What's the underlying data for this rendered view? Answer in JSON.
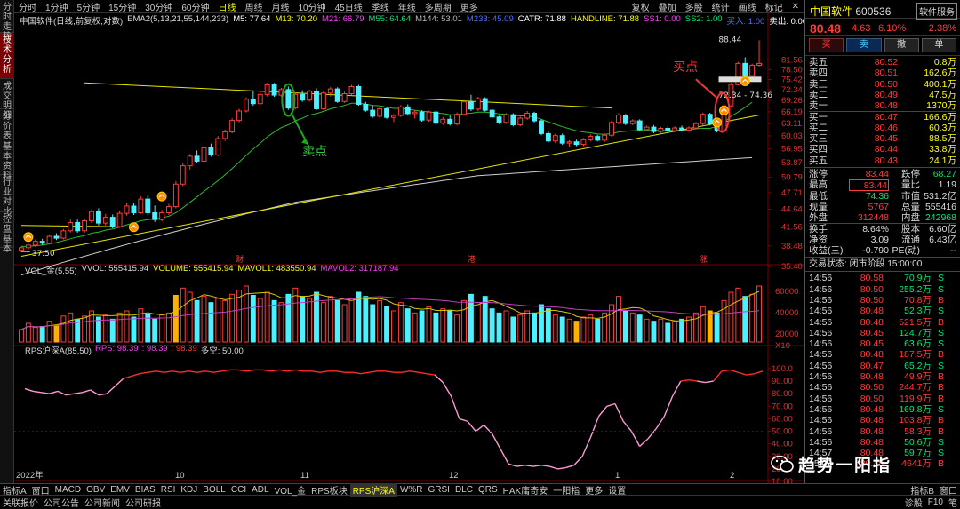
{
  "left_tabs": [
    "分时走势",
    "技术分析",
    "成交明细",
    "分价表",
    "基本资料",
    "行业对比",
    "控盘基本"
  ],
  "periods": [
    "分时",
    "1分钟",
    "5分钟",
    "15分钟",
    "30分钟",
    "60分钟",
    "日线",
    "周线",
    "月线",
    "10分钟",
    "45日线",
    "季线",
    "年线",
    "多周期",
    "更多"
  ],
  "active_period": "日线",
  "tools": [
    "复权",
    "叠加",
    "多股",
    "统计",
    "画线",
    "标记"
  ],
  "main_header": {
    "title": "中国软件(日线,前复权,对数)",
    "ema": "EMA2(5,13,21,55,144,233)",
    "m5": "M5: 77.64",
    "m13": "M13: 70.20",
    "m21": "M21: 66.79",
    "m55": "M55: 64.64",
    "m144": "M144: 53.01",
    "m233": "M233: 45.09",
    "catr": "CATR: 71.88",
    "handline": "HANDLINE: 71.88",
    "ss1": "SS1: 0.00",
    "ss2": "SS2: 1.00",
    "buy": "买入: 1.00",
    "sell": "卖出: 0.00"
  },
  "price_axis": [
    "81.56",
    "78.50",
    "75.42",
    "72.34",
    "69.26",
    "66.19",
    "63.11",
    "60.03",
    "56.95",
    "53.87",
    "50.79",
    "47.71",
    "44.64",
    "41.56",
    "38.48",
    "35.40"
  ],
  "annotations": {
    "high": "88.44",
    "range": "72.34 - 74.36",
    "low": "37.50",
    "sell_label": "卖点",
    "buy_label": "买点",
    "events": [
      "财",
      "港",
      "涨"
    ]
  },
  "vol_header": {
    "title": "VOL_金(5,55)",
    "vvol": "VVOL: 555415.94",
    "volume": "VOLUME: 555415.94",
    "mavol1": "MAVOL1: 483550.94",
    "mavol2": "MAVOL2: 317187.94"
  },
  "vol_axis": [
    "60000",
    "40000",
    "20000",
    "X10"
  ],
  "rps_header": {
    "title": "RPS沪深A(85,50)",
    "rps": "RPS: 98.39",
    "v2": ": 98.39",
    "v3": ": 98.39",
    "ds": "多空: 50.00"
  },
  "rps_axis": [
    "100.0",
    "90.00",
    "80.00",
    "70.00",
    "60.00",
    "50.00",
    "40.00",
    "30.00",
    "20.00",
    "10.00"
  ],
  "date_labels": [
    "2022年",
    "10",
    "11",
    "12",
    "1",
    "2"
  ],
  "chart_data": {
    "type": "candlestick",
    "title": "中国软件(日线,前复权,对数)",
    "ylim": [
      35.4,
      88.5
    ],
    "log_scale": true,
    "candles": [
      [
        37.8,
        38.4,
        37.5,
        38.2
      ],
      [
        38.2,
        38.8,
        37.9,
        38.6
      ],
      [
        38.6,
        39.5,
        38.3,
        39.2
      ],
      [
        39.2,
        39.6,
        38.6,
        38.9
      ],
      [
        38.9,
        40.3,
        38.7,
        40.0
      ],
      [
        40.0,
        40.5,
        39.4,
        39.7
      ],
      [
        39.7,
        41.2,
        39.5,
        40.9
      ],
      [
        40.9,
        42.8,
        40.6,
        42.3
      ],
      [
        42.3,
        42.8,
        40.6,
        40.9
      ],
      [
        40.9,
        43.0,
        40.6,
        42.6
      ],
      [
        42.6,
        44.6,
        42.2,
        44.2
      ],
      [
        44.2,
        44.8,
        41.8,
        42.2
      ],
      [
        42.2,
        43.8,
        41.8,
        43.2
      ],
      [
        43.2,
        43.7,
        41.3,
        41.6
      ],
      [
        41.6,
        44.4,
        41.4,
        43.9
      ],
      [
        43.9,
        45.7,
        43.5,
        45.2
      ],
      [
        45.2,
        45.7,
        43.6,
        44.0
      ],
      [
        44.0,
        47.0,
        43.8,
        46.5
      ],
      [
        46.5,
        47.2,
        43.6,
        44.0
      ],
      [
        44.0,
        45.3,
        42.4,
        42.8
      ],
      [
        42.8,
        44.5,
        42.5,
        44.0
      ],
      [
        44.0,
        45.6,
        43.6,
        45.1
      ],
      [
        45.1,
        50.0,
        44.8,
        49.4
      ],
      [
        49.4,
        53.8,
        49.0,
        53.2
      ],
      [
        53.2,
        55.8,
        52.4,
        55.3
      ],
      [
        55.3,
        56.6,
        53.8,
        54.2
      ],
      [
        54.2,
        57.8,
        53.8,
        57.2
      ],
      [
        57.2,
        58.2,
        55.2,
        55.6
      ],
      [
        55.6,
        60.0,
        55.3,
        59.4
      ],
      [
        59.4,
        61.6,
        58.8,
        61.0
      ],
      [
        61.0,
        64.5,
        60.7,
        63.9
      ],
      [
        63.9,
        67.0,
        63.4,
        66.4
      ],
      [
        66.4,
        70.2,
        66.0,
        69.6
      ],
      [
        69.6,
        72.0,
        67.8,
        68.4
      ],
      [
        68.4,
        71.5,
        68.0,
        71.0
      ],
      [
        71.0,
        74.4,
        70.4,
        73.8
      ],
      [
        73.8,
        74.4,
        70.3,
        70.8
      ],
      [
        70.8,
        72.9,
        70.3,
        72.4
      ],
      [
        72.4,
        73.3,
        66.7,
        67.2
      ],
      [
        67.2,
        71.5,
        66.8,
        71.0
      ],
      [
        71.0,
        72.2,
        68.9,
        69.4
      ],
      [
        69.4,
        72.4,
        69.0,
        71.9
      ],
      [
        71.9,
        72.8,
        66.6,
        67.0
      ],
      [
        67.0,
        72.0,
        66.6,
        71.4
      ],
      [
        71.4,
        73.2,
        70.4,
        72.6
      ],
      [
        72.6,
        73.1,
        68.6,
        69.0
      ],
      [
        69.0,
        71.8,
        68.6,
        71.2
      ],
      [
        71.2,
        73.8,
        70.8,
        73.3
      ],
      [
        73.3,
        73.8,
        67.8,
        68.2
      ],
      [
        68.2,
        68.9,
        66.2,
        66.6
      ],
      [
        66.6,
        68.0,
        64.6,
        65.0
      ],
      [
        65.0,
        67.5,
        64.6,
        67.0
      ],
      [
        67.0,
        67.6,
        64.3,
        64.7
      ],
      [
        64.7,
        65.6,
        63.5,
        65.2
      ],
      [
        65.2,
        68.0,
        64.8,
        67.5
      ],
      [
        67.5,
        68.2,
        65.3,
        65.7
      ],
      [
        65.7,
        66.6,
        64.4,
        66.1
      ],
      [
        66.1,
        66.6,
        63.6,
        64.0
      ],
      [
        64.0,
        66.5,
        63.6,
        66.1
      ],
      [
        66.1,
        66.6,
        62.8,
        63.2
      ],
      [
        63.2,
        64.8,
        62.8,
        64.2
      ],
      [
        64.2,
        65.4,
        62.6,
        63.0
      ],
      [
        63.0,
        66.0,
        62.6,
        65.5
      ],
      [
        65.5,
        69.4,
        65.2,
        68.9
      ],
      [
        68.9,
        70.9,
        66.4,
        66.9
      ],
      [
        66.9,
        70.3,
        66.4,
        69.8
      ],
      [
        69.8,
        70.2,
        66.2,
        66.6
      ],
      [
        66.6,
        67.0,
        64.4,
        64.8
      ],
      [
        64.8,
        65.1,
        63.0,
        63.4
      ],
      [
        63.4,
        65.8,
        63.0,
        65.4
      ],
      [
        65.4,
        65.8,
        62.4,
        62.8
      ],
      [
        62.8,
        64.9,
        62.4,
        64.5
      ],
      [
        64.5,
        66.4,
        64.1,
        65.8
      ],
      [
        65.8,
        66.2,
        63.4,
        63.8
      ],
      [
        63.8,
        64.2,
        60.2,
        60.6
      ],
      [
        60.6,
        61.1,
        58.4,
        58.8
      ],
      [
        58.8,
        60.6,
        58.3,
        60.1
      ],
      [
        60.1,
        60.6,
        57.9,
        58.3
      ],
      [
        58.3,
        59.0,
        57.5,
        58.6
      ],
      [
        58.6,
        59.1,
        57.6,
        58.0
      ],
      [
        58.0,
        59.5,
        57.6,
        59.1
      ],
      [
        59.1,
        60.4,
        58.7,
        59.9
      ],
      [
        59.9,
        60.3,
        58.7,
        59.0
      ],
      [
        59.0,
        60.6,
        58.6,
        60.2
      ],
      [
        60.2,
        63.9,
        59.8,
        63.4
      ],
      [
        63.4,
        65.8,
        62.9,
        65.3
      ],
      [
        65.3,
        65.6,
        62.7,
        63.1
      ],
      [
        63.1,
        64.2,
        62.7,
        63.8
      ],
      [
        63.8,
        64.2,
        61.2,
        61.6
      ],
      [
        61.6,
        62.6,
        61.2,
        62.2
      ],
      [
        62.2,
        62.7,
        60.7,
        61.1
      ],
      [
        61.1,
        62.3,
        60.7,
        61.9
      ],
      [
        61.9,
        62.4,
        60.9,
        61.3
      ],
      [
        61.3,
        62.4,
        60.9,
        62.0
      ],
      [
        62.0,
        62.6,
        61.1,
        61.5
      ],
      [
        61.5,
        62.4,
        61.1,
        62.0
      ],
      [
        62.0,
        63.5,
        61.6,
        63.1
      ],
      [
        63.1,
        66.0,
        62.6,
        65.5
      ],
      [
        65.5,
        65.9,
        62.6,
        63.0
      ],
      [
        63.0,
        63.4,
        60.9,
        61.3
      ],
      [
        61.3,
        68.3,
        61.1,
        67.8
      ],
      [
        67.8,
        74.4,
        67.4,
        73.9
      ],
      [
        73.9,
        81.0,
        73.6,
        80.5
      ],
      [
        80.5,
        82.5,
        76.2,
        76.6
      ],
      [
        76.6,
        80.4,
        76.2,
        79.9
      ],
      [
        79.9,
        88.4,
        79.5,
        80.5
      ]
    ],
    "ma_green": [
      38.4,
      38.4,
      38.5,
      38.6,
      38.8,
      39.0,
      39.3,
      39.6,
      39.9,
      40.1,
      40.5,
      40.7,
      41.0,
      41.2,
      41.5,
      41.9,
      42.2,
      42.6,
      42.8,
      42.9,
      43.1,
      43.4,
      44.0,
      44.9,
      45.9,
      46.9,
      48.0,
      49.0,
      50.1,
      51.3,
      52.6,
      54.0,
      55.5,
      56.9,
      58.3,
      59.8,
      61.0,
      62.1,
      62.8,
      63.8,
      64.5,
      65.3,
      65.7,
      66.3,
      67.0,
      67.4,
      67.9,
      68.5,
      68.5,
      68.3,
      67.9,
      67.8,
      67.4,
      67.1,
      67.1,
      66.9,
      66.6,
      66.3,
      66.2,
      65.9,
      65.7,
      65.4,
      65.4,
      65.7,
      65.8,
      66.1,
      66.1,
      65.9,
      65.6,
      65.5,
      65.2,
      65.1,
      65.1,
      64.8,
      64.2,
      63.5,
      62.9,
      62.3,
      61.8,
      61.3,
      61.0,
      60.8,
      60.5,
      60.4,
      60.6,
      61.0,
      61.2,
      61.3,
      61.4,
      61.4,
      61.4,
      61.4,
      61.4,
      61.4,
      61.4,
      61.5,
      61.8,
      61.9,
      61.9,
      62.4,
      63.4,
      65.0,
      66.1,
      67.4,
      68.8
    ],
    "ma_white": [
      34.2,
      34.5,
      34.8,
      35.1,
      35.4,
      35.7,
      36.0,
      36.3,
      36.6,
      36.9,
      37.2,
      37.5,
      37.8,
      38.1,
      38.4,
      38.7,
      39.0,
      39.3,
      39.6,
      39.9,
      40.2,
      40.5,
      40.8,
      41.1,
      41.4,
      41.7,
      42.0,
      42.3,
      42.6,
      42.9,
      43.2,
      43.5,
      43.8,
      44.1,
      44.4,
      44.7,
      45.0,
      45.3,
      45.6,
      45.9,
      46.1,
      46.3,
      46.5,
      46.7,
      46.9,
      47.1,
      47.3,
      47.5,
      47.7,
      47.9,
      48.1,
      48.3,
      48.5,
      48.7,
      48.9,
      49.1,
      49.3,
      49.5,
      49.7,
      49.9,
      50.1,
      50.3,
      50.5,
      50.7,
      50.9,
      51.1,
      51.2,
      51.3,
      51.4,
      51.5,
      51.6,
      51.7,
      51.8,
      51.9,
      52.0,
      52.1,
      52.2,
      52.3,
      52.4,
      52.5,
      52.6,
      52.7,
      52.8,
      52.9,
      53.0,
      53.1,
      53.2,
      53.3,
      53.4,
      53.5,
      53.6,
      53.7,
      53.8,
      53.9,
      54.0,
      54.1,
      54.2,
      54.3,
      54.4,
      54.5,
      54.6,
      54.7,
      54.8,
      54.9,
      55.0
    ],
    "trend_lines": [
      {
        "color": "#e6e600",
        "points": [
          [
            9,
            74.4
          ],
          [
            84,
            67.2
          ]
        ]
      },
      {
        "color": "#e6e600",
        "points": [
          [
            0,
            36.9
          ],
          [
            105,
            65.3
          ]
        ]
      },
      {
        "color": "#e6e600",
        "points": [
          [
            0,
            41.8
          ],
          [
            13,
            41.6
          ]
        ]
      }
    ],
    "volume": [
      12,
      18,
      14,
      15,
      20,
      16,
      25,
      28,
      22,
      25,
      30,
      24,
      26,
      22,
      28,
      30,
      24,
      32,
      27,
      22,
      26,
      28,
      45,
      52,
      48,
      40,
      44,
      38,
      42,
      40,
      46,
      50,
      54,
      45,
      42,
      48,
      40,
      38,
      46,
      52,
      44,
      42,
      48,
      38,
      44,
      40,
      36,
      42,
      48,
      44,
      36,
      40,
      34,
      30,
      38,
      32,
      28,
      30,
      34,
      28,
      32,
      30,
      26,
      40,
      46,
      38,
      44,
      32,
      28,
      30,
      24,
      26,
      30,
      28,
      36,
      32,
      26,
      24,
      22,
      20,
      24,
      26,
      22,
      28,
      36,
      44,
      30,
      28,
      26,
      22,
      20,
      22,
      18,
      20,
      22,
      24,
      28,
      34,
      30,
      28,
      40,
      48,
      52,
      44,
      46,
      54
    ],
    "volume_highlight": [
      5,
      22,
      79,
      98
    ],
    "rps": [
      84,
      82,
      81,
      80,
      82,
      79,
      80,
      81,
      83,
      79,
      80,
      86,
      92,
      94,
      96,
      97,
      98,
      97,
      98,
      97,
      98,
      97,
      98,
      97,
      98,
      99,
      99,
      98,
      99,
      99,
      98,
      99,
      98,
      99,
      98,
      98,
      97,
      98,
      98,
      97,
      97,
      96,
      97,
      98,
      98,
      97,
      97,
      98,
      97,
      96,
      95,
      89,
      78,
      60,
      58,
      50,
      55,
      48,
      36,
      24,
      22,
      23,
      22,
      23,
      22,
      20,
      21,
      23,
      30,
      45,
      62,
      70,
      72,
      58,
      50,
      38,
      44,
      52,
      62,
      78,
      90,
      91,
      90,
      89,
      90,
      98,
      99,
      97,
      95,
      96,
      98
    ]
  }
}
